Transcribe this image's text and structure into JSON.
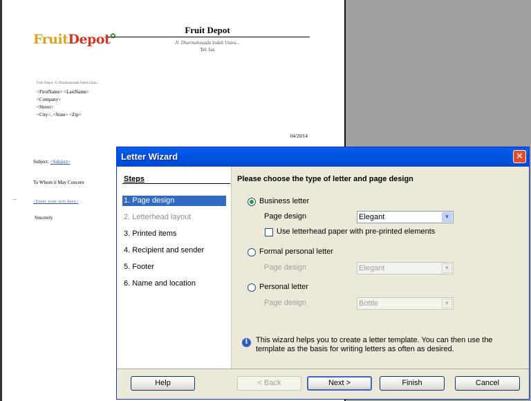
{
  "document": {
    "logo": {
      "part1": "Fruit",
      "part2": "Depot"
    },
    "company_name": "Fruit Depot",
    "company_address_line1": "Jl. Dharmahusada Indah Utara...",
    "company_address_line2": "Tel. fax",
    "sender_address": "Fruit Depot, Jl. Dharmahusada Indah Utara...",
    "recipient": {
      "name": "<FirstName> <LastName>",
      "company": "<Company>",
      "street": "<Street>",
      "city_line": "<City>, <State> <Zip>"
    },
    "date": "04/20/14",
    "subject_label": "Subject:",
    "subject_field": "<Subject>",
    "salutation": "To Whom it May Concern",
    "body_field": "<Enter your text here>",
    "closing": "Sincerely"
  },
  "wizard": {
    "title": "Letter Wizard",
    "close_symbol": "✕",
    "steps_heading": "Steps",
    "steps": [
      {
        "label": "1. Page design"
      },
      {
        "label": "2. Letterhead layout"
      },
      {
        "label": "3. Printed items"
      },
      {
        "label": "4. Recipient and sender"
      },
      {
        "label": "5. Footer"
      },
      {
        "label": "6. Name and location"
      }
    ],
    "selected_step": "1. Page design",
    "heading": "Please choose the type of letter and page design",
    "business_letter": {
      "label": "Business letter",
      "page_design_label": "Page design",
      "page_design_value": "Elegant",
      "letterhead_checkbox_label": "Use letterhead paper with pre-printed elements"
    },
    "formal_letter": {
      "label": "Formal personal letter",
      "page_design_label": "Page design",
      "page_design_value": "Elegant"
    },
    "personal_letter": {
      "label": "Personal letter",
      "page_design_label": "Page design",
      "page_design_value": "Bottle"
    },
    "info_text": "This wizard helps you to create a letter template. You can then use the template as the basis for writing letters as often as desired.",
    "buttons": {
      "help": "Help",
      "back": "< Back",
      "next": "Next >",
      "finish": "Finish",
      "cancel": "Cancel"
    },
    "icons": {
      "info": "info-icon",
      "dropdown": "chevron-down-icon",
      "close": "close-icon"
    },
    "colors": {
      "titlebar": "#0054e3",
      "selected_step": "#316ac5",
      "close_button": "#e24e2b",
      "radio_dot": "#21a121"
    }
  }
}
